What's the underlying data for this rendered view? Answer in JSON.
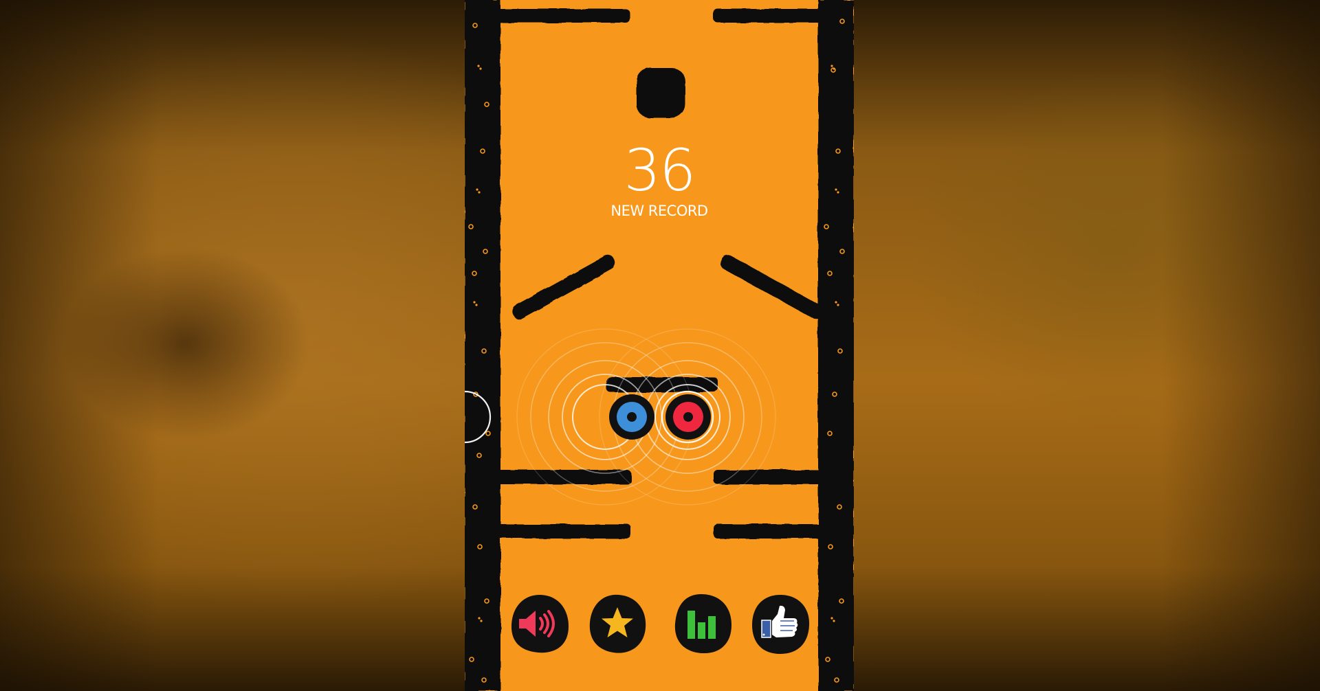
{
  "game": {
    "score": "36",
    "record_label": "NEW RECORD"
  },
  "colors": {
    "background_orange": "#f7981c",
    "ink": "#111111",
    "blue_ball": "#3d8fd9",
    "red_ball": "#f0283f",
    "sound_icon": "#f03a5a",
    "star_icon": "#f6b61f",
    "leaderboard_icon": "#3ec13a",
    "like_icon": "#3a5fa6"
  },
  "buttons": {
    "sound": "speaker-icon",
    "rate": "star-icon",
    "leaderboard": "bar-chart-icon",
    "like": "thumbs-up-icon"
  }
}
